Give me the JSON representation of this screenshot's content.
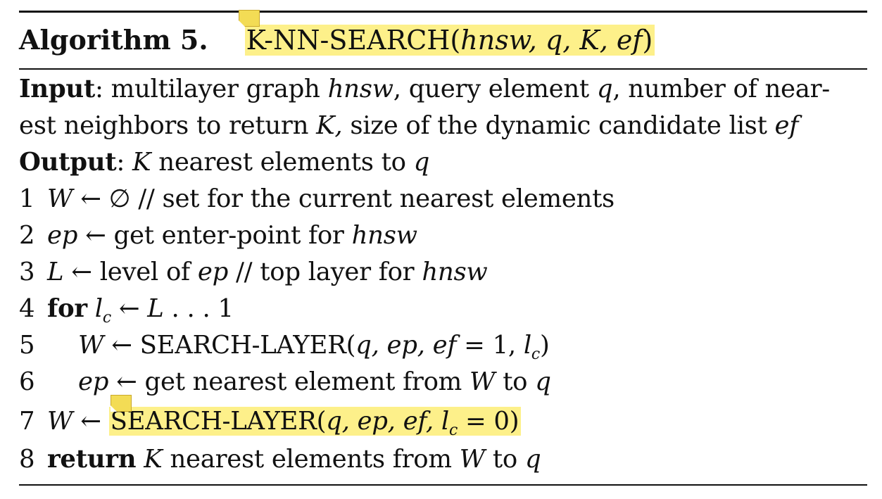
{
  "header": {
    "label": "Algorithm 5.",
    "name": "K-NN-SEARCH(",
    "params": "hnsw, q, K, ef",
    "close": ")"
  },
  "input": {
    "label": "Input",
    "colon": ":",
    "t1": " multilayer graph ",
    "v1": "hnsw",
    "t2": ", query element ",
    "v2": "q",
    "t3": ", number of near-",
    "t4": "est neighbors to return ",
    "v3": "K,",
    "t5": " size of the dynamic candidate list ",
    "v4": "ef"
  },
  "output": {
    "label": "Output",
    "colon": ":",
    "v1": "K",
    "t1": " nearest elements to ",
    "v2": "q"
  },
  "steps": [
    {
      "num": "1",
      "v": "W",
      "t": " ← ∅ // set for the current nearest elements"
    },
    {
      "num": "2",
      "v": "ep",
      "t": " ← get enter-point for ",
      "v2": "hnsw"
    },
    {
      "num": "3",
      "v": "L",
      "t": " ← level of ",
      "v2": "ep",
      "t2": " // top layer for ",
      "v3": "hnsw"
    },
    {
      "num": "4",
      "kw": "for",
      "v": "l",
      "sub": "c",
      "t": " ← ",
      "v2": "L",
      "t2": " . . . 1"
    },
    {
      "num": "5",
      "v": "W",
      "t": " ← SEARCH-LAYER(",
      "v2": "q, ep, ef",
      "t2": " = 1, ",
      "v3": "l",
      "sub": "c",
      "t3": ")"
    },
    {
      "num": "6",
      "v": "ep",
      "t": " ← get nearest element from ",
      "v2": "W",
      "t2": " to ",
      "v3": "q"
    },
    {
      "num": "7",
      "v": "W",
      "t": " ← ",
      "t_hl": "SEARCH-LAYER(",
      "v2": "q, ep, ef, l",
      "sub": "c",
      "t2": " = 0)"
    },
    {
      "num": "8",
      "kw": "return",
      "v": "K",
      "t": " nearest elements from ",
      "v2": "W",
      "t2": " to ",
      "v3": "q"
    }
  ]
}
